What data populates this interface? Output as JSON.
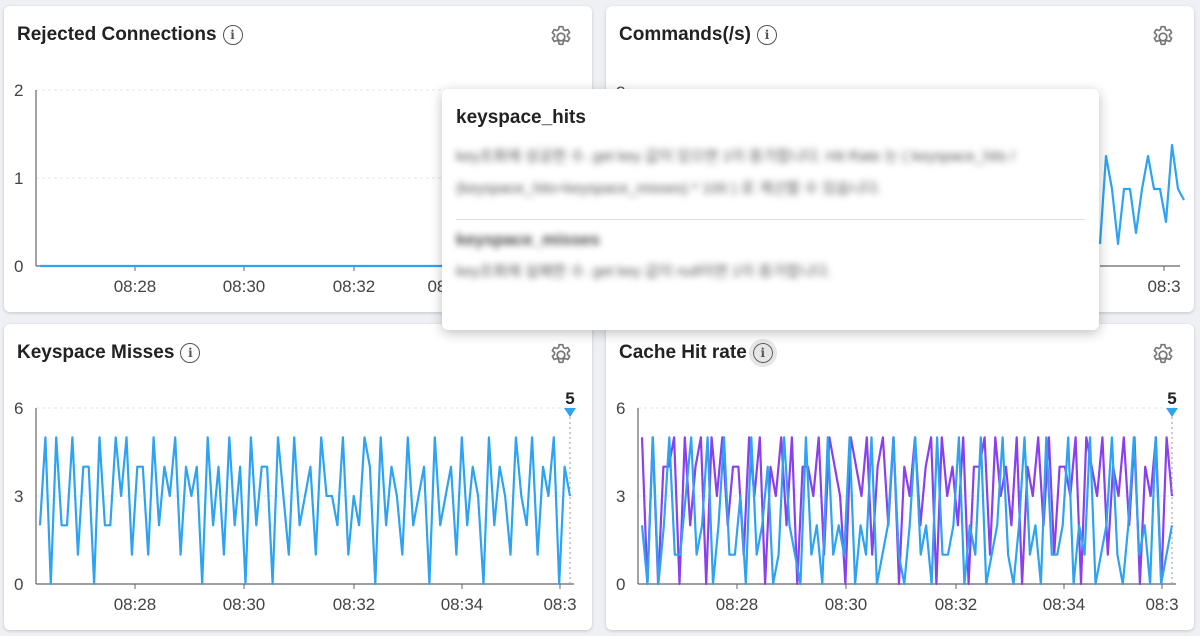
{
  "panels": [
    {
      "id": "p1",
      "title": "Rejected Connections",
      "chart_data": {
        "type": "line",
        "title": "Rejected Connections",
        "ylim": [
          0,
          2
        ],
        "yticks": [
          "0",
          "1",
          "2"
        ],
        "xticks": [
          "08:28",
          "08:30",
          "08:32",
          "08:3"
        ],
        "series": [
          {
            "color": "#2ea3f2",
            "values": [
              0,
              0,
              0,
              0,
              0,
              0,
              0,
              0,
              0,
              0,
              0,
              0,
              0,
              0,
              0,
              0,
              0,
              0,
              0,
              0
            ]
          }
        ],
        "marker": null
      }
    },
    {
      "id": "p2",
      "title": "Commands(/s)",
      "chart_data": {
        "type": "line",
        "title": "Commands(/s)",
        "ylim": [
          0,
          8
        ],
        "yticks": [
          "8"
        ],
        "xticks": [
          "08:3"
        ],
        "series": [
          {
            "color": "#2ea3f2",
            "values": [
              1,
              5,
              3.5,
              1,
              3.5,
              3.5,
              1.5,
              3.5,
              5,
              3.5,
              3.5,
              2,
              5.5,
              3.5,
              3
            ]
          }
        ],
        "marker": null
      }
    },
    {
      "id": "p3",
      "title": "Keyspace Misses",
      "chart_data": {
        "type": "line",
        "title": "Keyspace Misses",
        "ylim": [
          0,
          6
        ],
        "yticks": [
          "0",
          "3",
          "6"
        ],
        "xticks": [
          "08:28",
          "08:30",
          "08:32",
          "08:34",
          "08:3"
        ],
        "series": [
          {
            "color": "#2ea3f2",
            "values": [
              2,
              5,
              0,
              5,
              2,
              2,
              5,
              1,
              4,
              4,
              0,
              5,
              2,
              2,
              5,
              3,
              5,
              1,
              4,
              4,
              1,
              5,
              2,
              4,
              3,
              5,
              1,
              4,
              3,
              4,
              0,
              5,
              2,
              4,
              1,
              5,
              2,
              4,
              0,
              5,
              2,
              4,
              4,
              0,
              5,
              3,
              1,
              5,
              2,
              3,
              4,
              1,
              5,
              3,
              3,
              2,
              5,
              1,
              3,
              2,
              5,
              4,
              0,
              5,
              2,
              4,
              3,
              1,
              5,
              2,
              3,
              4,
              0,
              5,
              2,
              3,
              4,
              1,
              5,
              2,
              4,
              3,
              0,
              5,
              2,
              4,
              3,
              1,
              5,
              3,
              2,
              5,
              1,
              4,
              3,
              5,
              0,
              4,
              3
            ]
          }
        ],
        "marker": {
          "label": "5",
          "color": "#2ea3f2"
        }
      }
    },
    {
      "id": "p4",
      "title": "Cache Hit rate",
      "chart_data": {
        "type": "line",
        "title": "Cache Hit rate",
        "ylim": [
          0,
          6
        ],
        "yticks": [
          "0",
          "3",
          "6"
        ],
        "xticks": [
          "08:28",
          "08:30",
          "08:32",
          "08:34",
          "08:3"
        ],
        "series": [
          {
            "color": "#8a3ff0",
            "values": [
              5,
              0,
              5,
              0,
              4,
              4,
              5,
              0,
              5,
              2,
              4,
              5,
              0,
              5,
              3,
              5,
              2,
              4,
              4,
              1,
              5,
              3,
              5,
              0,
              4,
              3,
              5,
              2,
              5,
              0,
              4,
              4,
              3,
              5,
              1,
              5,
              4,
              3,
              0,
              5,
              4,
              3,
              5,
              1,
              4,
              5,
              2,
              5,
              0,
              4,
              3,
              5,
              2,
              4,
              5,
              0,
              5,
              3,
              4,
              2,
              5,
              0,
              4,
              4,
              5,
              1,
              5,
              3,
              4,
              2,
              5,
              0,
              4,
              3,
              5,
              2,
              5,
              1,
              4,
              4,
              3,
              5,
              0,
              5,
              4,
              3,
              5,
              1,
              4,
              3,
              5,
              2,
              5,
              0,
              4,
              3,
              5,
              0,
              5,
              3
            ]
          },
          {
            "color": "#2ea3f2",
            "values": [
              2,
              0,
              5,
              0,
              2,
              5,
              1,
              1,
              3,
              5,
              1,
              2,
              5,
              0,
              2,
              5,
              1,
              1,
              3,
              0,
              5,
              1,
              2,
              4,
              0,
              1,
              5,
              2,
              1,
              0,
              5,
              1,
              2,
              0,
              5,
              1,
              2,
              1,
              5,
              0,
              2,
              1,
              5,
              0,
              1,
              2,
              5,
              1,
              0,
              2,
              5,
              1,
              2,
              0,
              5,
              1,
              1,
              2,
              5,
              0,
              2,
              1,
              5,
              0,
              1,
              2,
              5,
              1,
              0,
              2,
              5,
              1,
              2,
              0,
              5,
              1,
              1,
              2,
              5,
              0,
              2,
              1,
              5,
              0,
              1,
              2,
              5,
              1,
              0,
              2,
              5,
              1,
              2,
              0,
              5,
              0,
              1,
              2
            ]
          }
        ],
        "marker": {
          "label": "5",
          "color": "#2ea3f2"
        }
      }
    }
  ],
  "tooltip": {
    "title": "keyspace_hits",
    "description": "key조회에 성공한 수. get key 값이 있으면 1이 증가합니다. Hit Rate 는 ( keyspace_hits / (keyspace_hits+keyspace_misses) * 100 ) 로 계산할 수 있습니다.",
    "title2": "keyspace_misses",
    "description2": "key조회에 실패한 수. get key 값이 null이면 1이 증가합니다."
  }
}
